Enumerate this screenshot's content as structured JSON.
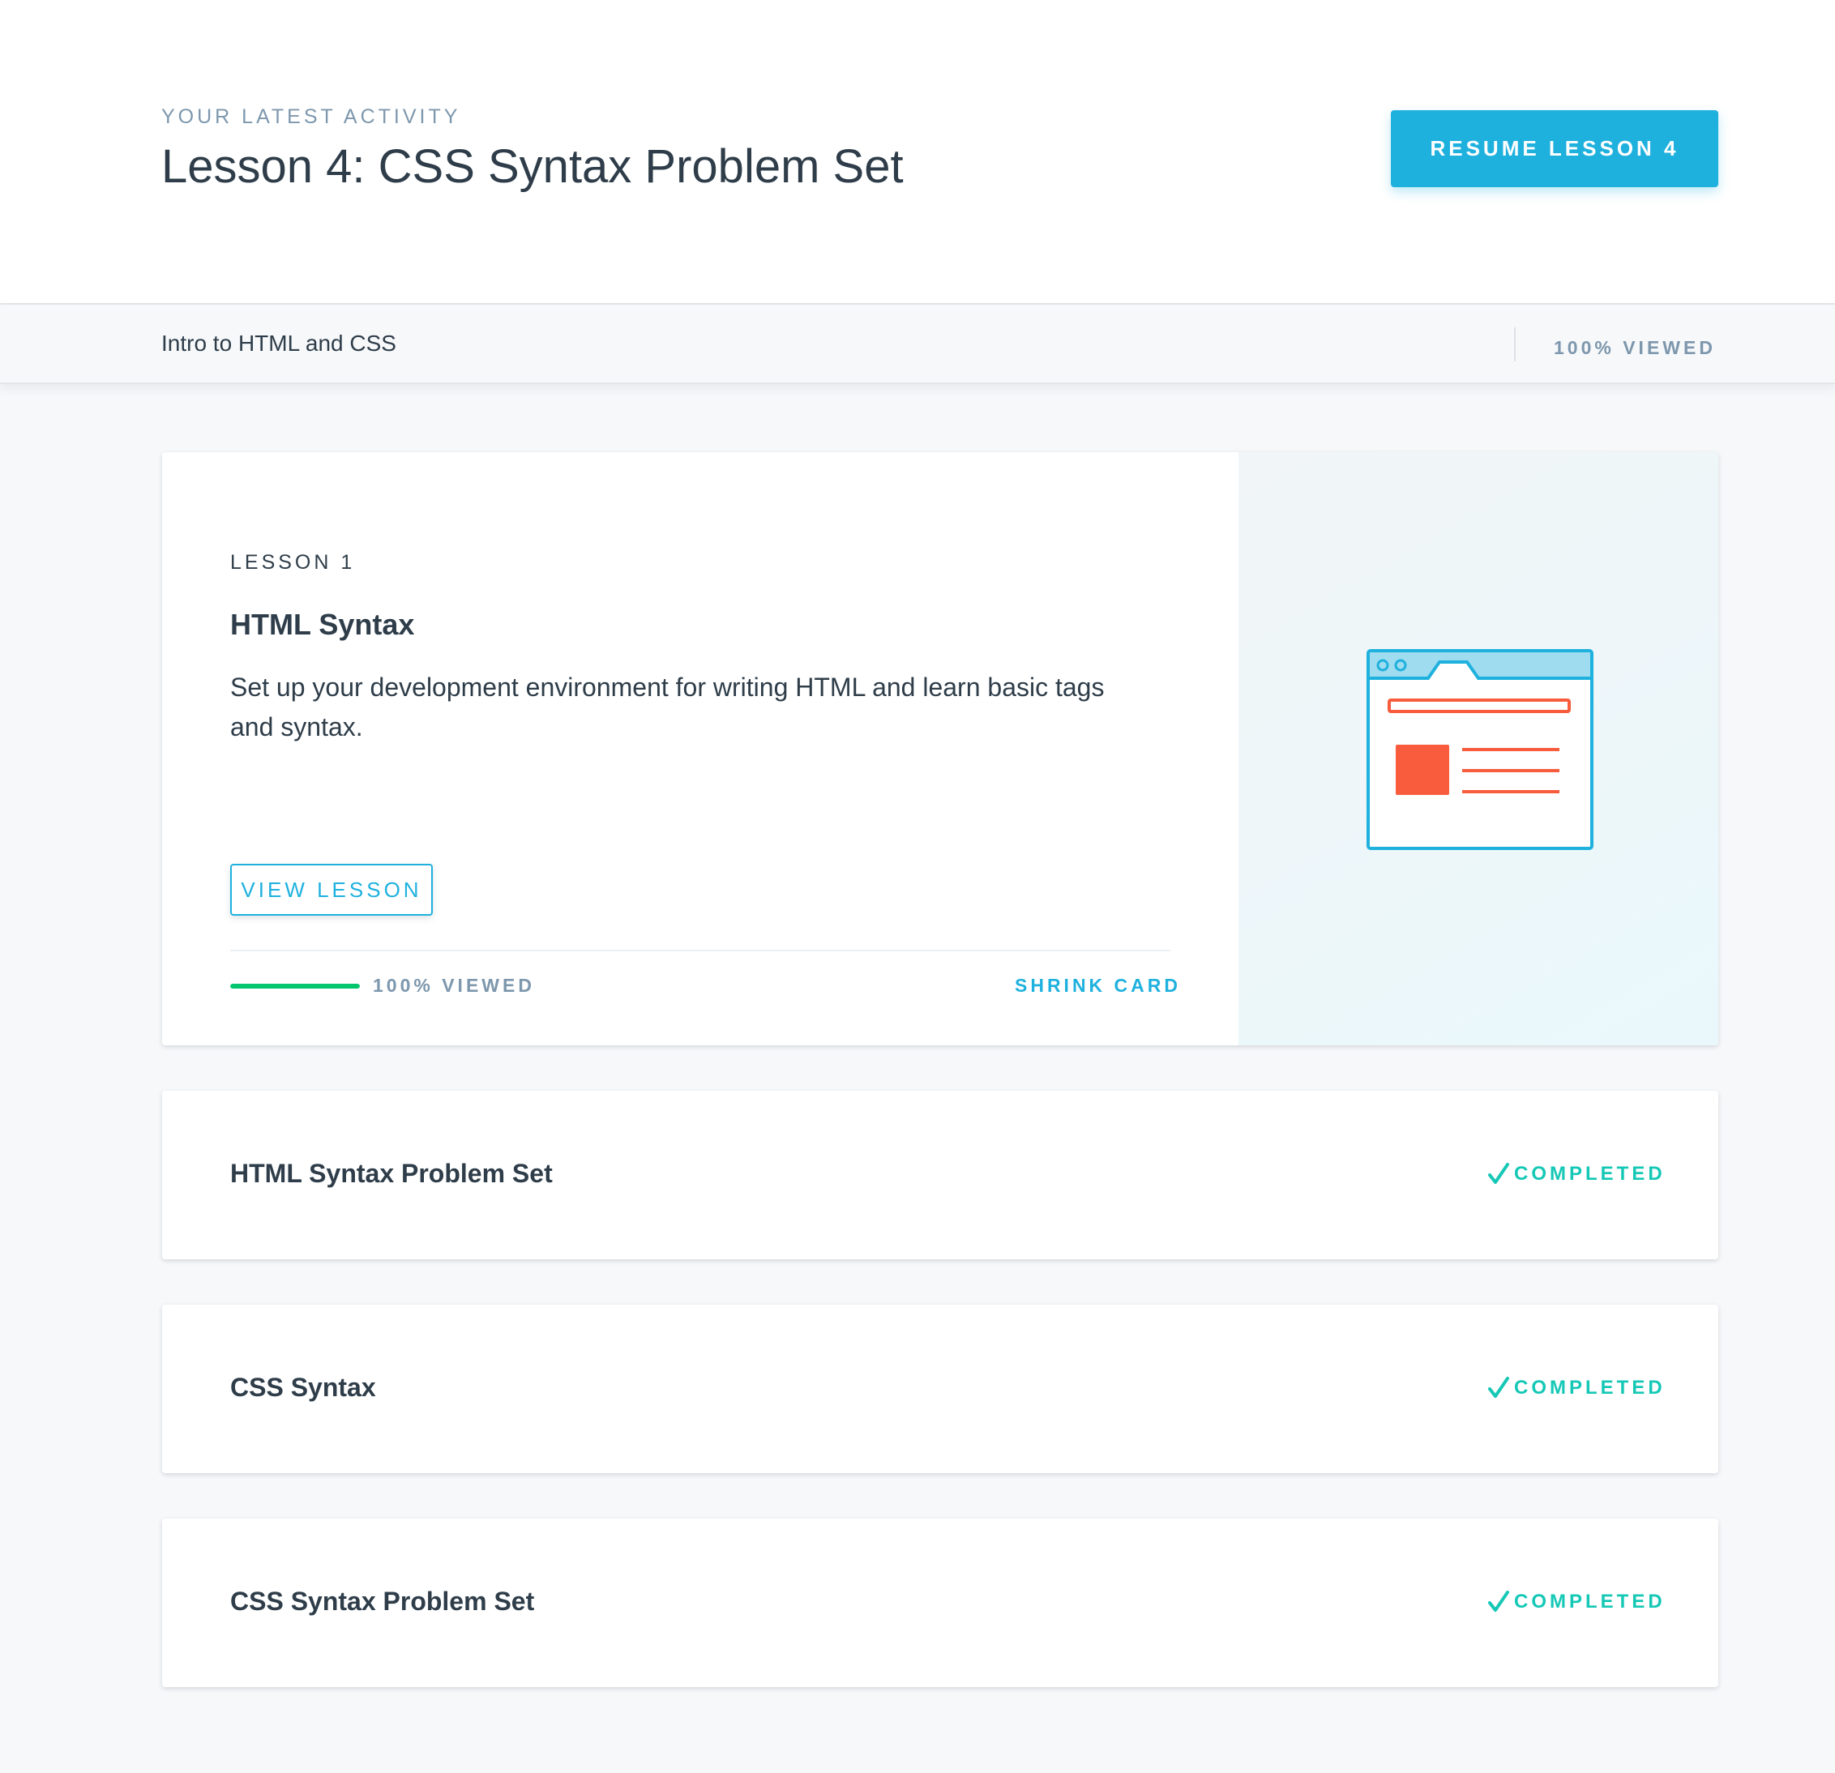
{
  "header": {
    "eyebrow": "YOUR LATEST ACTIVITY",
    "title": "Lesson 4: CSS Syntax Problem Set",
    "resume_label": "RESUME LESSON 4"
  },
  "course": {
    "name": "Intro to HTML and CSS",
    "viewed": "100% VIEWED"
  },
  "expanded_lesson": {
    "label": "LESSON 1",
    "title": "HTML Syntax",
    "description": "Set up your development environment for writing HTML and learn basic tags and syntax.",
    "view_label": "VIEW LESSON",
    "progress_fraction": 1.0,
    "viewed": "100% VIEWED",
    "shrink_label": "SHRINK CARD",
    "art_icon": "browser-window-icon"
  },
  "lessons": [
    {
      "title": "HTML Syntax Problem Set",
      "status": "COMPLETED"
    },
    {
      "title": "CSS Syntax",
      "status": "COMPLETED"
    },
    {
      "title": "CSS Syntax Problem Set",
      "status": "COMPLETED"
    }
  ],
  "colors": {
    "accent": "#1fb1de",
    "progress": "#02c66e",
    "completed": "#15c8b6",
    "art_orange": "#f95c3c",
    "text": "#2e3d49",
    "muted": "#7d97ad"
  }
}
